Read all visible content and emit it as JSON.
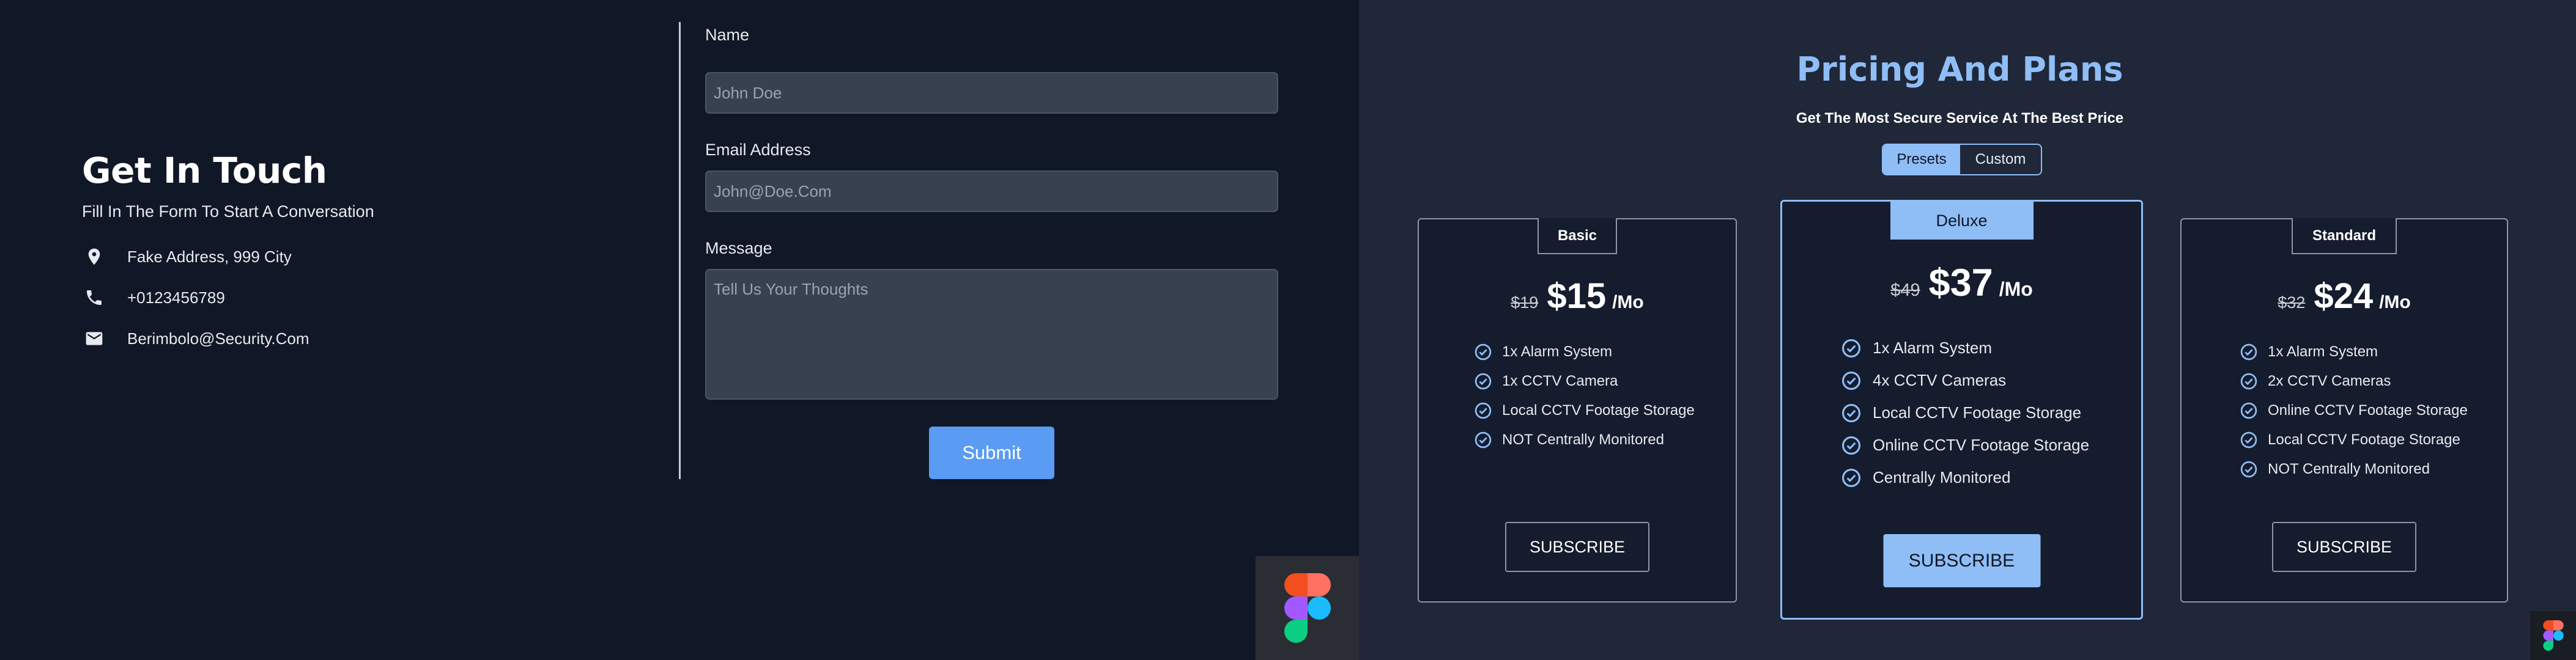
{
  "contact": {
    "title": "Get In Touch",
    "subtitle": "Fill In The Form To Start A Conversation",
    "address": "Fake Address, 999 City",
    "phone": "+0123456789",
    "email": "Berimbolo@Security.Com",
    "address_icon": "map-pin-icon",
    "phone_icon": "phone-icon",
    "email_icon": "mail-icon"
  },
  "form": {
    "name_label": "Name",
    "name_placeholder": "John Doe",
    "email_label": "Email Address",
    "email_placeholder": "John@Doe.Com",
    "message_label": "Message",
    "message_placeholder": "Tell Us Your Thoughts",
    "submit_label": "Submit"
  },
  "pricing": {
    "title": "Pricing And Plans",
    "subtitle": "Get The Most Secure Service At The Best Price",
    "toggle": {
      "presets": "Presets",
      "custom": "Custom",
      "active": "presets"
    },
    "plans": [
      {
        "name": "Basic",
        "old_price": "$19",
        "price": "$15",
        "period": "/Mo",
        "features": [
          "1x Alarm System",
          "1x CCTV Camera",
          "Local CCTV Footage Storage",
          "NOT Centrally Monitored"
        ],
        "cta": "SUBSCRIBE"
      },
      {
        "name": "Deluxe",
        "old_price": "$49",
        "price": "$37",
        "period": "/Mo",
        "features": [
          "1x Alarm System",
          "4x CCTV Cameras",
          "Local CCTV Footage Storage",
          "Online CCTV Footage Storage",
          "Centrally Monitored"
        ],
        "cta": "SUBSCRIBE"
      },
      {
        "name": "Standard",
        "old_price": "$32",
        "price": "$24",
        "period": "/Mo",
        "features": [
          "1x Alarm System",
          "2x CCTV Cameras",
          "Online CCTV Footage Storage",
          "Local CCTV Footage Storage",
          "NOT Centrally Monitored"
        ],
        "cta": "SUBSCRIBE"
      }
    ]
  },
  "colors": {
    "left_bg": "#101726",
    "right_bg": "#1f2738",
    "accent": "#8fbdf6",
    "submit": "#5a9bf4"
  },
  "badges": {
    "figma": "figma-logo-icon"
  }
}
